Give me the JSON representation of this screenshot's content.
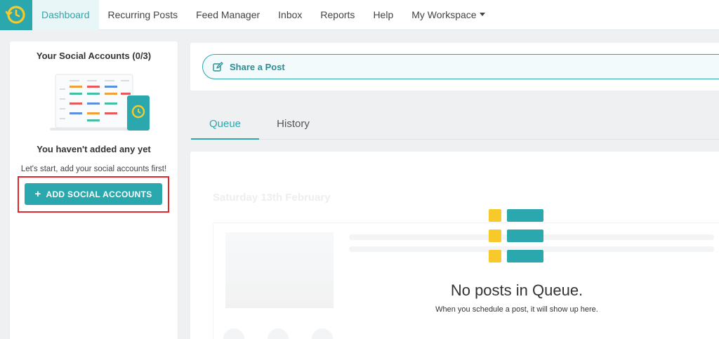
{
  "nav": {
    "logo_icon": "clock-logo-icon",
    "items": [
      {
        "label": "Dashboard",
        "active": true
      },
      {
        "label": "Recurring Posts"
      },
      {
        "label": "Feed Manager"
      },
      {
        "label": "Inbox"
      },
      {
        "label": "Reports"
      },
      {
        "label": "Help"
      },
      {
        "label": "My Workspace",
        "dropdown": true
      }
    ]
  },
  "accounts_panel": {
    "title": "Your Social Accounts (0/3)",
    "empty_title": "You haven't added any yet",
    "hint": "Let's start, add your social accounts first!",
    "add_button": "ADD SOCIAL ACCOUNTS"
  },
  "share": {
    "label": "Share a Post",
    "icon": "edit-icon"
  },
  "tabs": [
    {
      "label": "Queue",
      "active": true
    },
    {
      "label": "History"
    }
  ],
  "queue": {
    "ghost_date": "Saturday 13th February",
    "empty_title": "No posts in Queue.",
    "empty_hint": "When you schedule a post, it will show up here."
  },
  "colors": {
    "brand": "#2aa8ad",
    "accent_yellow": "#f7c92b",
    "highlight": "#e0282e"
  }
}
